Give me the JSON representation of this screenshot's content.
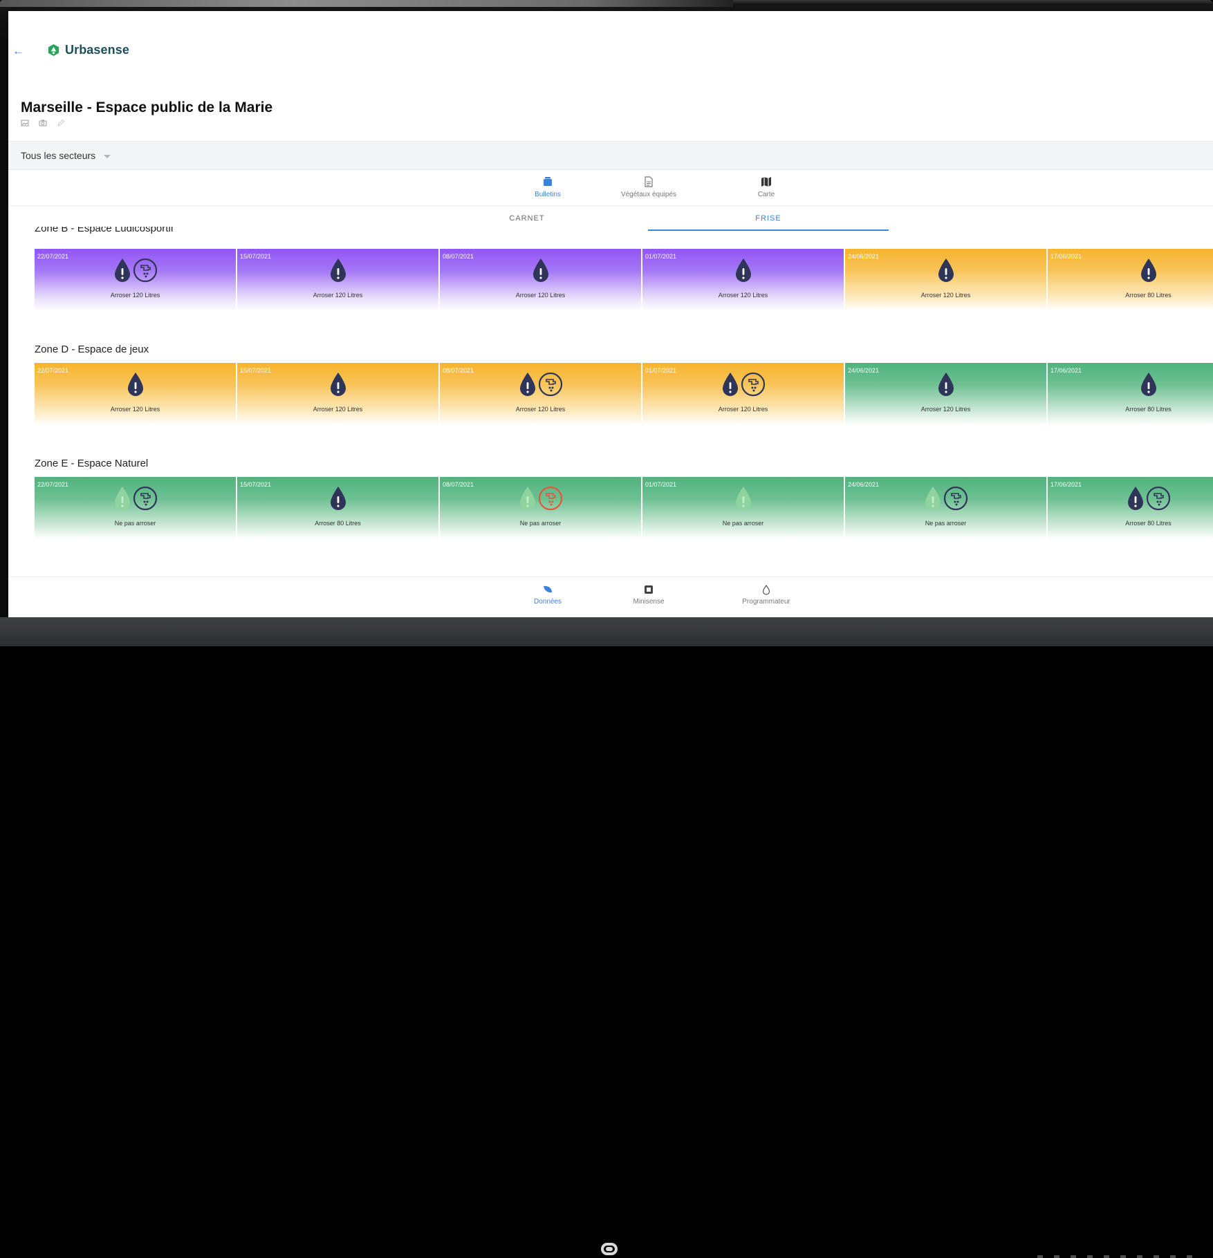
{
  "app": {
    "brand_name": "Urbasense",
    "page_title": "Marseille - Espace public de la Marie",
    "colors": {
      "accent": "#3b82d9",
      "violet": "#9255f5",
      "orange": "#f7b42d",
      "green": "#4fb37d",
      "drop_dark": "#2f3558",
      "warning_red": "#e05a3a"
    }
  },
  "header": {
    "back_icon": "arrow-left-icon",
    "title_tools": [
      "image-icon",
      "camera-icon",
      "pencil-icon"
    ]
  },
  "sector_filter": {
    "label": "Tous les secteurs",
    "icon": "caret-down-icon"
  },
  "section_nav": [
    {
      "label": "Bulletins",
      "icon": "bulletin-icon",
      "active": true
    },
    {
      "label": "Végétaux équipés",
      "icon": "document-icon",
      "active": false
    },
    {
      "label": "Carte",
      "icon": "map-icon",
      "active": false
    }
  ],
  "sub_tabs": [
    {
      "label": "CARNET",
      "active": false
    },
    {
      "label": "FRISE",
      "active": true
    }
  ],
  "zones": [
    {
      "name": "Zone B - Espace Ludicosportif",
      "cells": [
        {
          "date": "22/07/2021",
          "color": "violet",
          "drop": "dark",
          "tap": "dark",
          "text": "Arroser 120 Litres"
        },
        {
          "date": "15/07/2021",
          "color": "violet",
          "drop": "dark",
          "tap": "",
          "text": "Arroser 120 Litres"
        },
        {
          "date": "08/07/2021",
          "color": "violet",
          "drop": "dark",
          "tap": "",
          "text": "Arroser 120 Litres"
        },
        {
          "date": "01/07/2021",
          "color": "violet",
          "drop": "dark",
          "tap": "",
          "text": "Arroser 120 Litres"
        },
        {
          "date": "24/06/2021",
          "color": "orange",
          "drop": "dark",
          "tap": "",
          "text": "Arroser 120 Litres"
        },
        {
          "date": "17/06/2021",
          "color": "orange",
          "drop": "dark",
          "tap": "",
          "text": "Arroser 80 Litres"
        }
      ]
    },
    {
      "name": "Zone D - Espace de jeux",
      "cells": [
        {
          "date": "22/07/2021",
          "color": "orange",
          "drop": "dark",
          "tap": "",
          "text": "Arroser 120 Litres"
        },
        {
          "date": "15/07/2021",
          "color": "orange",
          "drop": "dark",
          "tap": "",
          "text": "Arroser 120 Litres"
        },
        {
          "date": "08/07/2021",
          "color": "orange",
          "drop": "dark",
          "tap": "dark",
          "text": "Arroser 120 Litres"
        },
        {
          "date": "01/07/2021",
          "color": "orange",
          "drop": "dark",
          "tap": "dark",
          "text": "Arroser 120 Litres"
        },
        {
          "date": "24/06/2021",
          "color": "green",
          "drop": "dark",
          "tap": "",
          "text": "Arroser 120 Litres"
        },
        {
          "date": "17/06/2021",
          "color": "green",
          "drop": "dark",
          "tap": "",
          "text": "Arroser 80 Litres"
        }
      ]
    },
    {
      "name": "Zone E - Espace Naturel",
      "cells": [
        {
          "date": "22/07/2021",
          "color": "green",
          "drop": "light",
          "tap": "dark",
          "text": "Ne pas arroser"
        },
        {
          "date": "15/07/2021",
          "color": "green",
          "drop": "dark",
          "tap": "",
          "text": "Arroser 80 Litres"
        },
        {
          "date": "08/07/2021",
          "color": "green",
          "drop": "light",
          "tap": "red",
          "text": "Ne pas arroser"
        },
        {
          "date": "01/07/2021",
          "color": "green",
          "drop": "light",
          "tap": "",
          "text": "Ne pas arroser"
        },
        {
          "date": "24/06/2021",
          "color": "green",
          "drop": "light",
          "tap": "dark",
          "text": "Ne pas arroser"
        },
        {
          "date": "17/06/2021",
          "color": "green",
          "drop": "dark",
          "tap": "dark",
          "text": "Arroser 80 Litres"
        }
      ]
    }
  ],
  "bottom_nav": [
    {
      "label": "Données",
      "icon": "leaf-icon",
      "active": true
    },
    {
      "label": "Minisense",
      "icon": "chip-icon",
      "active": false
    },
    {
      "label": "Programmateur",
      "icon": "water-drop-outline-icon",
      "active": false
    }
  ]
}
